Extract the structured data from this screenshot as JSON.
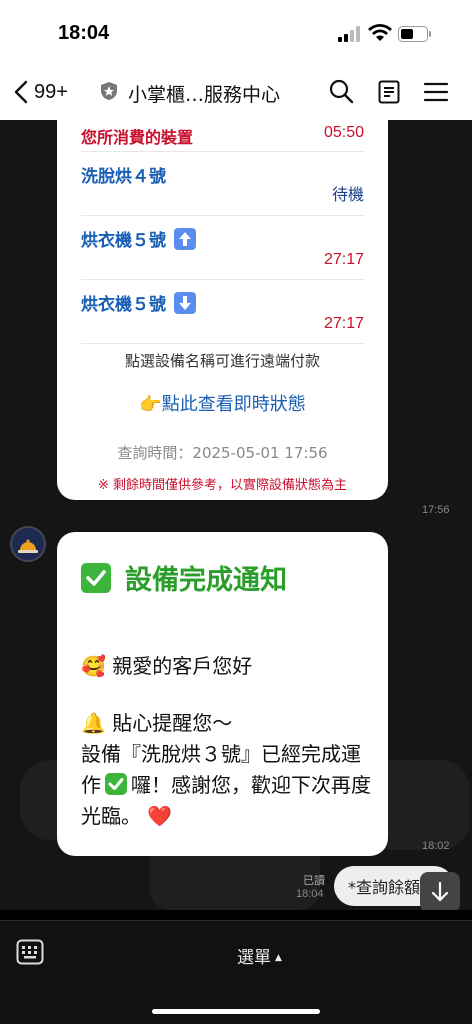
{
  "status": {
    "time": "18:04"
  },
  "nav": {
    "back_count": "99+",
    "title": "小掌櫃…服務中心"
  },
  "card1": {
    "header_label": "您所消費的裝置",
    "header_value": "05:50",
    "devices": [
      {
        "name": "洗脫烘４號",
        "status": "待機",
        "status_color": "#1a3f8f"
      },
      {
        "name": "烘衣機５號",
        "arrow": "up",
        "status": "27:17",
        "status_color": "#c8102e"
      },
      {
        "name": "烘衣機５號",
        "arrow": "down",
        "status": "27:17",
        "status_color": "#c8102e"
      }
    ],
    "note": "點選設備名稱可進行遠端付款",
    "link": "👉點此查看即時狀態",
    "query_time": "查詢時間：2025-05-01 17:56",
    "warning": "※ 剩餘時間僅供參考，以實際設備狀態為主",
    "timestamp": "17:56"
  },
  "card2": {
    "title": "設備完成通知",
    "greeting": "🥰 親愛的客戶您好",
    "line1": "🔔 貼心提醒您～",
    "line2": "設備『洗脫烘３號』已經完成運作",
    "line3": "囉！感謝您，歡迎下次再度光臨。",
    "heart": "❤️",
    "timestamp": "18:02"
  },
  "outgoing": {
    "read_label": "已讀",
    "timestamp": "18:04",
    "text": "*查詢餘額"
  },
  "bottom": {
    "menu_label": "選單"
  },
  "colors": {
    "accent_blue": "#1a5fb4",
    "alert_red": "#c8102e",
    "success_green": "#2a9d2a"
  }
}
